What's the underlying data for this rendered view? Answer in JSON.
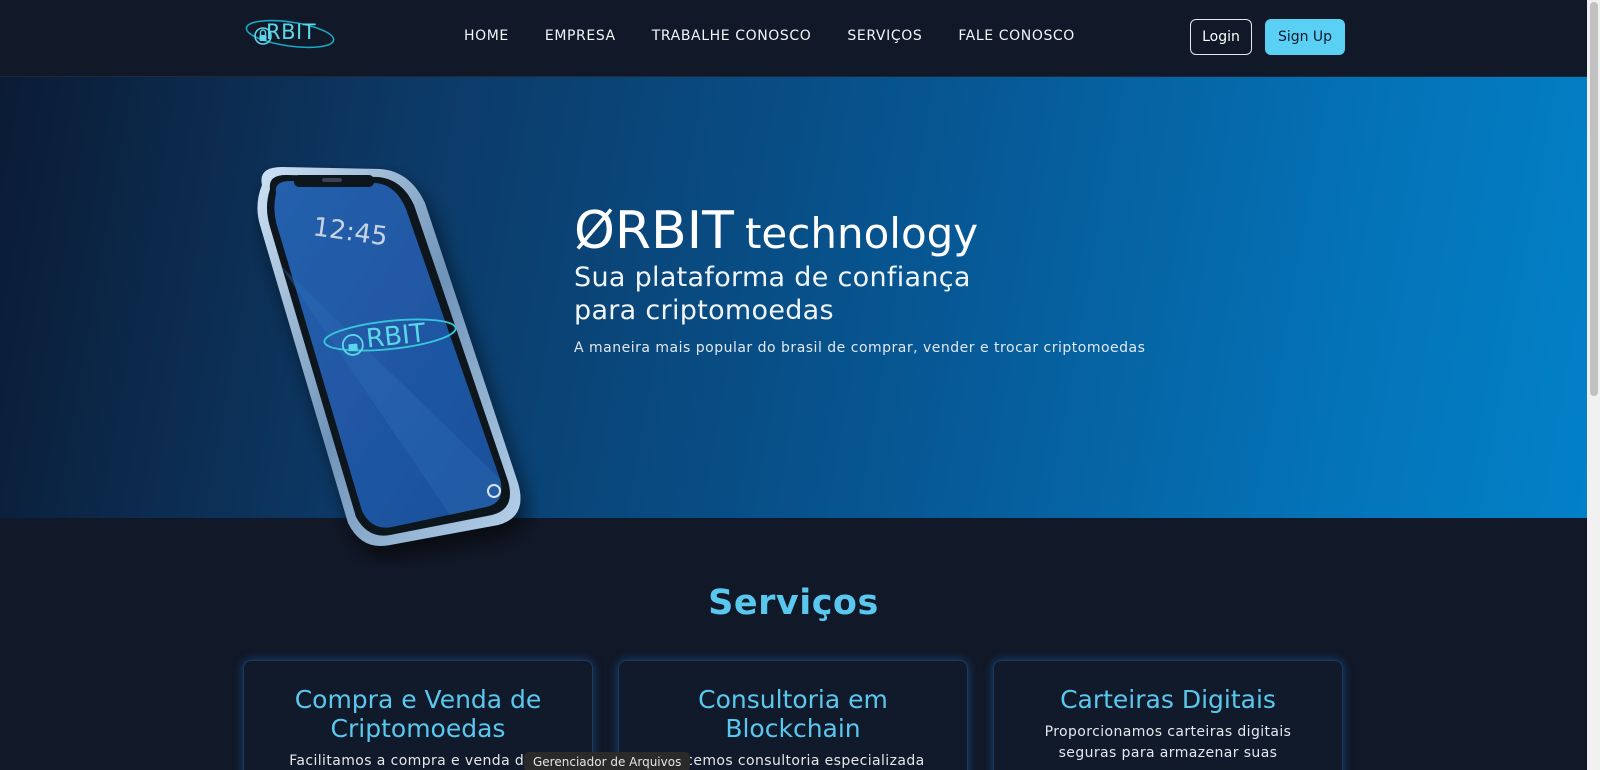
{
  "header": {
    "logo_text": "RBIT",
    "nav": [
      "HOME",
      "EMPRESA",
      "TRABALHE CONOSCO",
      "SERVIÇOS",
      "FALE CONOSCO"
    ],
    "login_label": "Login",
    "signup_label": "Sign Up"
  },
  "hero": {
    "brand": "ØRBIT",
    "tech": "technology",
    "subtitle_line1": "Sua plataforma de confiança",
    "subtitle_line2": "para criptomoedas",
    "description": "A maneira mais popular do brasil de comprar, vender e trocar criptomoedas",
    "phone_time": "12:45",
    "phone_logo": "RBIT"
  },
  "services": {
    "title": "Serviços",
    "cards": [
      {
        "title": "Compra e Venda de Criptomoedas",
        "text": "Facilitamos a compra e venda de v"
      },
      {
        "title": "Consultoria em Blockchain",
        "text": "erecemos consultoria especializada"
      },
      {
        "title": "Carteiras Digitais",
        "text": "Proporcionamos carteiras digitais seguras para armazenar suas"
      }
    ]
  },
  "tooltip": "Gerenciador de Arquivos",
  "colors": {
    "accent": "#5ac8ee",
    "signup_bg": "#5ad0f5",
    "page_bg": "#111827"
  }
}
